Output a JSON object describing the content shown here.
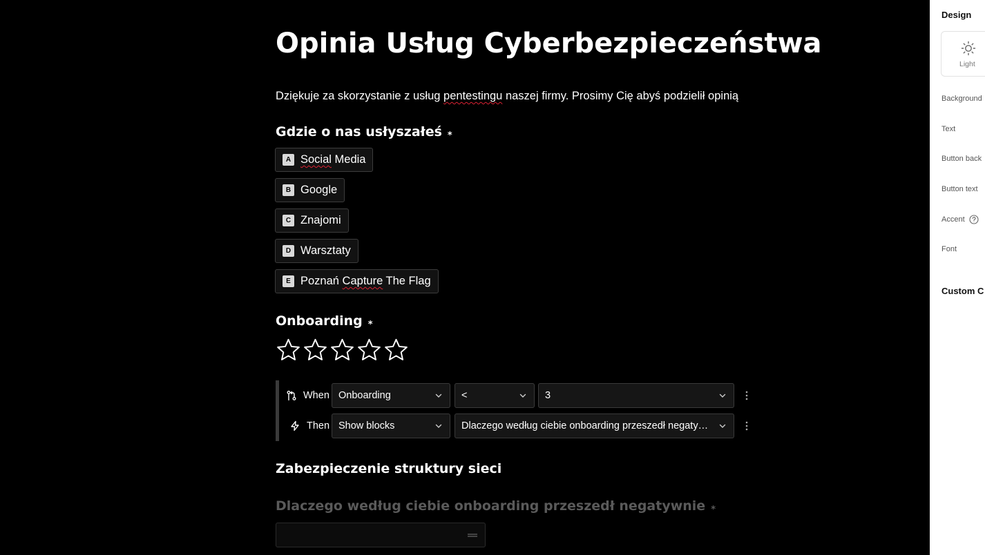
{
  "form": {
    "title": "Opinia Usług Cyberbezpieczeństwa",
    "intro_before": "Dziękuje za skorzystanie z usług ",
    "intro_misspelled": "pentestingu",
    "intro_after": " naszej firmy. Prosimy Cię abyś podzielił opinią"
  },
  "question1": {
    "title": "Gdzie o nas usłyszałeś",
    "required_mark": "*",
    "choices": [
      {
        "key": "A",
        "label": "Social Media"
      },
      {
        "key": "B",
        "label": "Google"
      },
      {
        "key": "C",
        "label": "Znajomi"
      },
      {
        "key": "D",
        "label": "Warsztaty"
      },
      {
        "key": "E",
        "label": "Poznań Capture The Flag"
      }
    ]
  },
  "question2": {
    "title": "Onboarding",
    "required_mark": "*",
    "rating_max": 5,
    "rating_value": 0
  },
  "logic": {
    "when_label": "When",
    "when_field": "Onboarding",
    "when_operator": "<",
    "when_value": "3",
    "then_label": "Then",
    "then_action": "Show blocks",
    "then_target": "Dlaczego według ciebie onboarding przeszedł negatywnie..."
  },
  "section3": {
    "title": "Zabezpieczenie struktury sieci"
  },
  "question4": {
    "title": "Dlaczego według ciebie onboarding przeszedł negatywnie",
    "required_mark": "*"
  },
  "design_panel": {
    "title": "Design",
    "theme_label": "Light",
    "items": [
      "Background",
      "Text",
      "Button back",
      "Button text",
      "Accent",
      "Font"
    ],
    "custom_label": "Custom C"
  },
  "colors": {
    "canvas_bg": "#000000",
    "panel_bg": "#ffffff",
    "spellcheck_underline": "#dd2233",
    "key_badge_bg": "#d9d9d9"
  }
}
